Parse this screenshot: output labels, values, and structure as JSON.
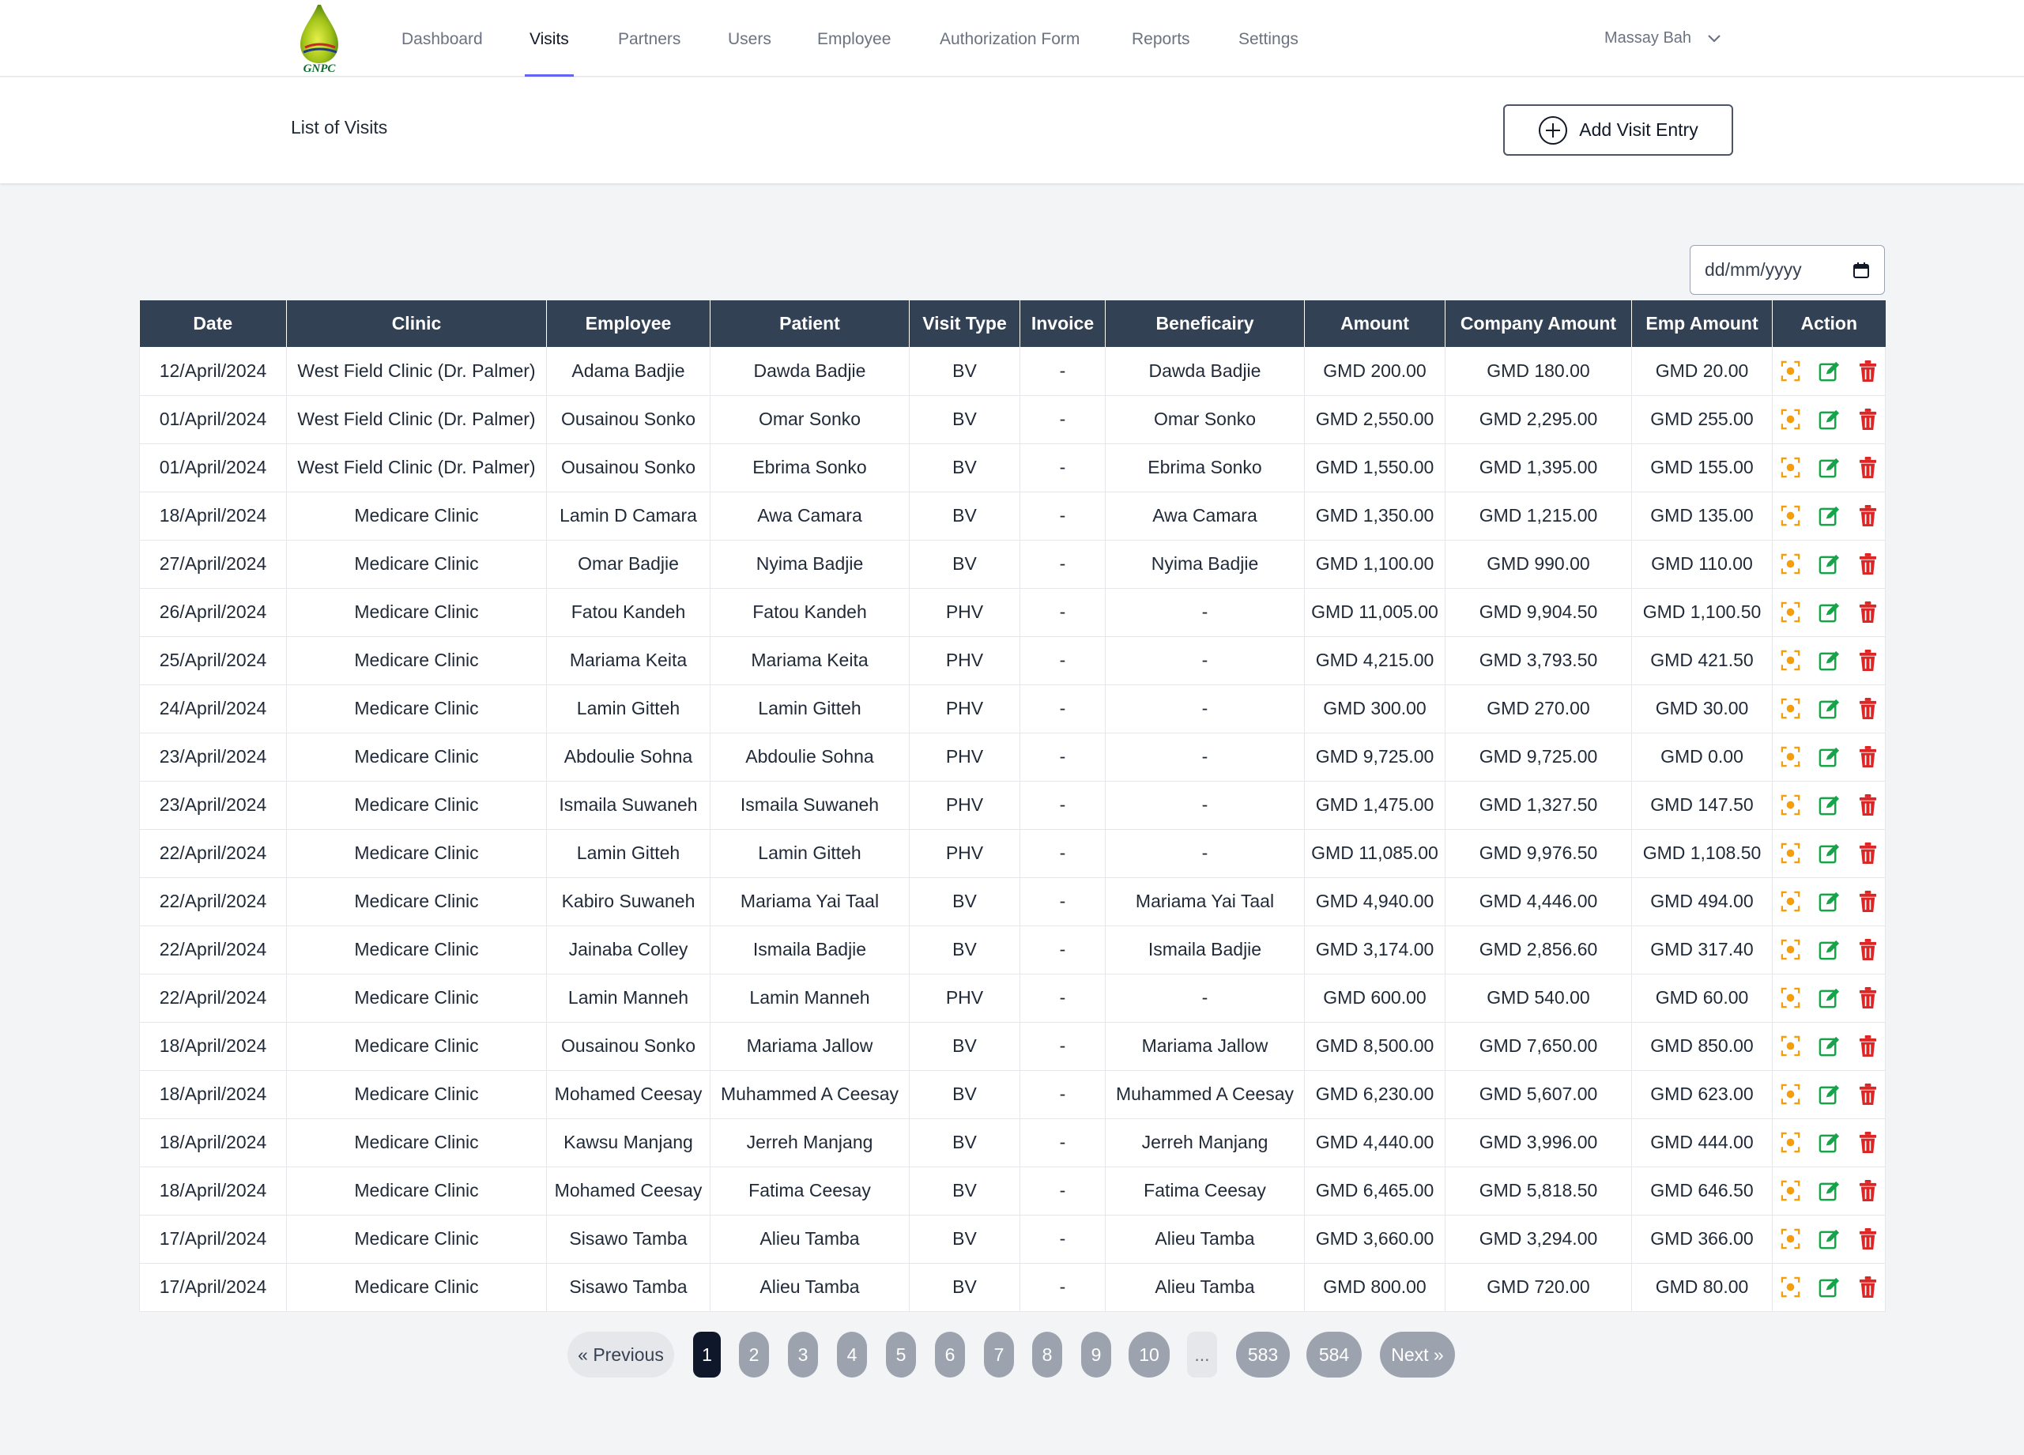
{
  "nav": {
    "logo_text": "GNPC",
    "links": [
      {
        "label": "Dashboard"
      },
      {
        "label": "Visits",
        "active": true
      },
      {
        "label": "Partners"
      },
      {
        "label": "Users"
      },
      {
        "label": "Employee"
      },
      {
        "label": "Authorization Form"
      },
      {
        "label": "Reports"
      },
      {
        "label": "Settings"
      }
    ],
    "user_name": "Massay Bah"
  },
  "header": {
    "title": "List of Visits",
    "add_button_label": "Add Visit Entry"
  },
  "filter": {
    "date_placeholder": "dd/mm/yyyy"
  },
  "table": {
    "columns": [
      "Date",
      "Clinic",
      "Employee",
      "Patient",
      "Visit Type",
      "Invoice",
      "Beneficairy",
      "Amount",
      "Company Amount",
      "Emp Amount",
      "Action"
    ],
    "rows": [
      [
        "12/April/2024",
        "West Field Clinic (Dr. Palmer)",
        "Adama Badjie",
        "Dawda Badjie",
        "BV",
        "-",
        "Dawda Badjie",
        "GMD 200.00",
        "GMD 180.00",
        "GMD 20.00"
      ],
      [
        "01/April/2024",
        "West Field Clinic (Dr. Palmer)",
        "Ousainou Sonko",
        "Omar Sonko",
        "BV",
        "-",
        "Omar Sonko",
        "GMD 2,550.00",
        "GMD 2,295.00",
        "GMD 255.00"
      ],
      [
        "01/April/2024",
        "West Field Clinic (Dr. Palmer)",
        "Ousainou Sonko",
        "Ebrima Sonko",
        "BV",
        "-",
        "Ebrima Sonko",
        "GMD 1,550.00",
        "GMD 1,395.00",
        "GMD 155.00"
      ],
      [
        "18/April/2024",
        "Medicare Clinic",
        "Lamin D Camara",
        "Awa Camara",
        "BV",
        "-",
        "Awa Camara",
        "GMD 1,350.00",
        "GMD 1,215.00",
        "GMD 135.00"
      ],
      [
        "27/April/2024",
        "Medicare Clinic",
        "Omar Badjie",
        "Nyima Badjie",
        "BV",
        "-",
        "Nyima Badjie",
        "GMD 1,100.00",
        "GMD 990.00",
        "GMD 110.00"
      ],
      [
        "26/April/2024",
        "Medicare Clinic",
        "Fatou Kandeh",
        "Fatou Kandeh",
        "PHV",
        "-",
        "-",
        "GMD 11,005.00",
        "GMD 9,904.50",
        "GMD 1,100.50"
      ],
      [
        "25/April/2024",
        "Medicare Clinic",
        "Mariama Keita",
        "Mariama Keita",
        "PHV",
        "-",
        "-",
        "GMD 4,215.00",
        "GMD 3,793.50",
        "GMD 421.50"
      ],
      [
        "24/April/2024",
        "Medicare Clinic",
        "Lamin Gitteh",
        "Lamin Gitteh",
        "PHV",
        "-",
        "-",
        "GMD 300.00",
        "GMD 270.00",
        "GMD 30.00"
      ],
      [
        "23/April/2024",
        "Medicare Clinic",
        "Abdoulie Sohna",
        "Abdoulie Sohna",
        "PHV",
        "-",
        "-",
        "GMD 9,725.00",
        "GMD 9,725.00",
        "GMD 0.00"
      ],
      [
        "23/April/2024",
        "Medicare Clinic",
        "Ismaila Suwaneh",
        "Ismaila Suwaneh",
        "PHV",
        "-",
        "-",
        "GMD 1,475.00",
        "GMD 1,327.50",
        "GMD 147.50"
      ],
      [
        "22/April/2024",
        "Medicare Clinic",
        "Lamin Gitteh",
        "Lamin Gitteh",
        "PHV",
        "-",
        "-",
        "GMD 11,085.00",
        "GMD 9,976.50",
        "GMD 1,108.50"
      ],
      [
        "22/April/2024",
        "Medicare Clinic",
        "Kabiro Suwaneh",
        "Mariama Yai Taal",
        "BV",
        "-",
        "Mariama Yai Taal",
        "GMD 4,940.00",
        "GMD 4,446.00",
        "GMD 494.00"
      ],
      [
        "22/April/2024",
        "Medicare Clinic",
        "Jainaba Colley",
        "Ismaila Badjie",
        "BV",
        "-",
        "Ismaila Badjie",
        "GMD 3,174.00",
        "GMD 2,856.60",
        "GMD 317.40"
      ],
      [
        "22/April/2024",
        "Medicare Clinic",
        "Lamin Manneh",
        "Lamin Manneh",
        "PHV",
        "-",
        "-",
        "GMD 600.00",
        "GMD 540.00",
        "GMD 60.00"
      ],
      [
        "18/April/2024",
        "Medicare Clinic",
        "Ousainou Sonko",
        "Mariama Jallow",
        "BV",
        "-",
        "Mariama Jallow",
        "GMD 8,500.00",
        "GMD 7,650.00",
        "GMD 850.00"
      ],
      [
        "18/April/2024",
        "Medicare Clinic",
        "Mohamed Ceesay",
        "Muhammed A Ceesay",
        "BV",
        "-",
        "Muhammed A Ceesay",
        "GMD 6,230.00",
        "GMD 5,607.00",
        "GMD 623.00"
      ],
      [
        "18/April/2024",
        "Medicare Clinic",
        "Kawsu Manjang",
        "Jerreh Manjang",
        "BV",
        "-",
        "Jerreh Manjang",
        "GMD 4,440.00",
        "GMD 3,996.00",
        "GMD 444.00"
      ],
      [
        "18/April/2024",
        "Medicare Clinic",
        "Mohamed Ceesay",
        "Fatima Ceesay",
        "BV",
        "-",
        "Fatima Ceesay",
        "GMD 6,465.00",
        "GMD 5,818.50",
        "GMD 646.50"
      ],
      [
        "17/April/2024",
        "Medicare Clinic",
        "Sisawo Tamba",
        "Alieu Tamba",
        "BV",
        "-",
        "Alieu Tamba",
        "GMD 3,660.00",
        "GMD 3,294.00",
        "GMD 366.00"
      ],
      [
        "17/April/2024",
        "Medicare Clinic",
        "Sisawo Tamba",
        "Alieu Tamba",
        "BV",
        "-",
        "Alieu Tamba",
        "GMD 800.00",
        "GMD 720.00",
        "GMD 80.00"
      ]
    ],
    "row_actions": [
      {
        "icon": "view-icon",
        "color": "#f59e0b"
      },
      {
        "icon": "edit-icon",
        "color": "#16a34a"
      },
      {
        "icon": "trash-icon",
        "color": "#dc2626"
      }
    ]
  },
  "pagination": {
    "prev_label": "« Previous",
    "next_label": "Next »",
    "current": "1",
    "pages": [
      "1",
      "2",
      "3",
      "4",
      "5",
      "6",
      "7",
      "8",
      "9",
      "10",
      "...",
      "583",
      "584"
    ]
  },
  "colors": {
    "accent": "#6366f1",
    "table_header": "#334155",
    "page_active": "#0f172a",
    "page_inactive": "#9ca3af"
  }
}
